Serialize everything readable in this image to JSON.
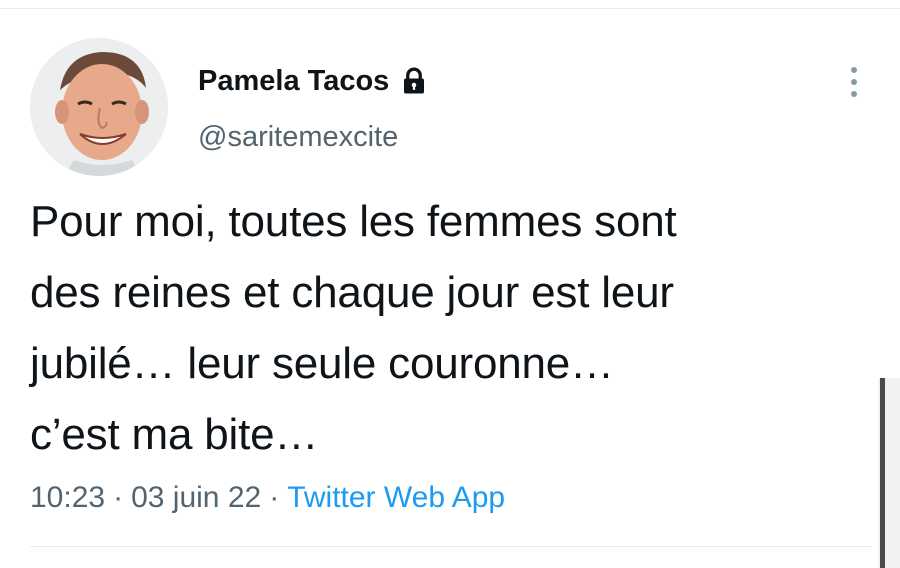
{
  "tweet": {
    "author": {
      "display_name": "Pamela Tacos",
      "handle": "@saritemexcite",
      "protected_icon": "lock-icon"
    },
    "text_lines": [
      "Pour moi, toutes les femmes sont",
      "des reines et chaque jour est leur",
      "jubilé… leur seule couronne…",
      "c’est ma bite…"
    ],
    "time": "10:23",
    "separator": "·",
    "date": "03 juin 22",
    "source": "Twitter Web App",
    "more_icon": "more-vertical-icon"
  },
  "colors": {
    "text_primary": "#0f1419",
    "text_secondary": "#536471",
    "link": "#1d9bf0"
  }
}
